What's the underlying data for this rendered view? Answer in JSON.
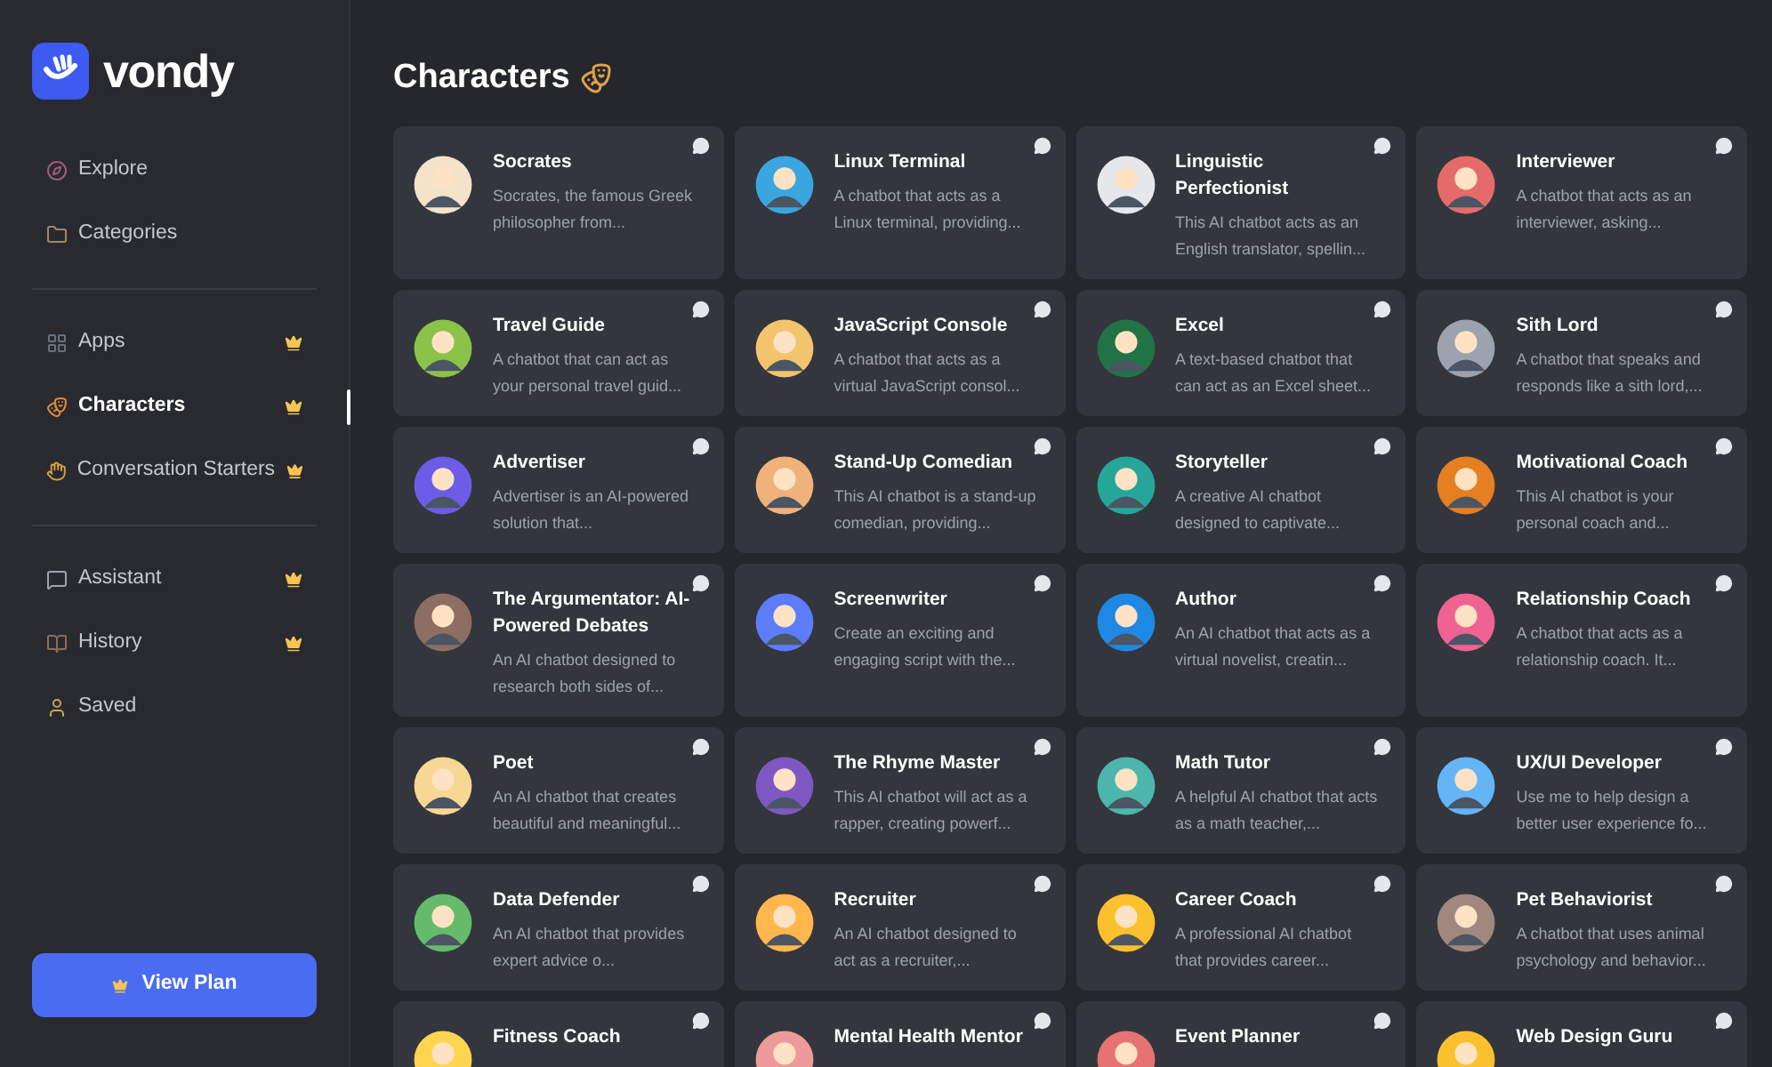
{
  "brand": {
    "name": "vondy"
  },
  "nav_groups": [
    {
      "items": [
        {
          "label": "Explore",
          "premium": false,
          "selected": false
        },
        {
          "label": "Categories",
          "premium": false,
          "selected": false
        }
      ]
    },
    {
      "items": [
        {
          "label": "Apps",
          "premium": true,
          "selected": false
        },
        {
          "label": "Characters",
          "premium": true,
          "selected": true
        },
        {
          "label": "Conversation Starters",
          "premium": true,
          "selected": false
        }
      ]
    },
    {
      "items": [
        {
          "label": "Assistant",
          "premium": true,
          "selected": false
        },
        {
          "label": "History",
          "premium": true,
          "selected": false
        },
        {
          "label": "Saved",
          "premium": false,
          "selected": false
        }
      ]
    }
  ],
  "plan_button": {
    "label": "View Plan"
  },
  "page_title": "Characters",
  "characters": [
    {
      "title": "Socrates",
      "description": "Socrates, the famous Greek philosopher from..."
    },
    {
      "title": "Linux Terminal",
      "description": "A chatbot that acts as a Linux terminal, providing..."
    },
    {
      "title": "Linguistic Perfectionist",
      "description": "This AI chatbot acts as an English translator, spellin..."
    },
    {
      "title": "Interviewer",
      "description": "A chatbot that acts as an interviewer, asking..."
    },
    {
      "title": "Travel Guide",
      "description": "A chatbot that can act as your personal travel guid..."
    },
    {
      "title": "JavaScript Console",
      "description": "A chatbot that acts as a virtual JavaScript consol..."
    },
    {
      "title": "Excel",
      "description": "A text-based chatbot that can act as an Excel sheet..."
    },
    {
      "title": "Sith Lord",
      "description": "A chatbot that speaks and responds like a sith lord,..."
    },
    {
      "title": "Advertiser",
      "description": "Advertiser is an AI-powered solution that..."
    },
    {
      "title": "Stand-Up Comedian",
      "description": "This AI chatbot is a stand-up comedian, providing..."
    },
    {
      "title": "Storyteller",
      "description": "A creative AI chatbot designed to captivate..."
    },
    {
      "title": "Motivational Coach",
      "description": "This AI chatbot is your personal coach and..."
    },
    {
      "title": "The Argumentator: AI-Powered Debates",
      "description": "An AI chatbot designed to research both sides of..."
    },
    {
      "title": "Screenwriter",
      "description": "Create an exciting and engaging script with the..."
    },
    {
      "title": "Author",
      "description": "An AI chatbot that acts as a virtual novelist, creatin..."
    },
    {
      "title": "Relationship Coach",
      "description": "A chatbot that acts as a relationship coach. It..."
    },
    {
      "title": "Poet",
      "description": "An AI chatbot that creates beautiful and meaningful..."
    },
    {
      "title": "The Rhyme Master",
      "description": "This AI chatbot will act as a rapper, creating powerf..."
    },
    {
      "title": "Math Tutor",
      "description": "A helpful AI chatbot that acts as a math teacher,..."
    },
    {
      "title": "UX/UI Developer",
      "description": "Use me to help design a better user experience fo..."
    },
    {
      "title": "Data Defender",
      "description": "An AI chatbot that provides expert advice o..."
    },
    {
      "title": "Recruiter",
      "description": "An AI chatbot designed to act as a recruiter,..."
    },
    {
      "title": "Career Coach",
      "description": "A professional AI chatbot that provides career..."
    },
    {
      "title": "Pet Behaviorist",
      "description": "A chatbot that uses animal psychology and behavior..."
    },
    {
      "title": "Fitness Coach"
    },
    {
      "title": "Mental Health Mentor"
    },
    {
      "title": "Event Planner"
    },
    {
      "title": "Web Design Guru"
    }
  ]
}
